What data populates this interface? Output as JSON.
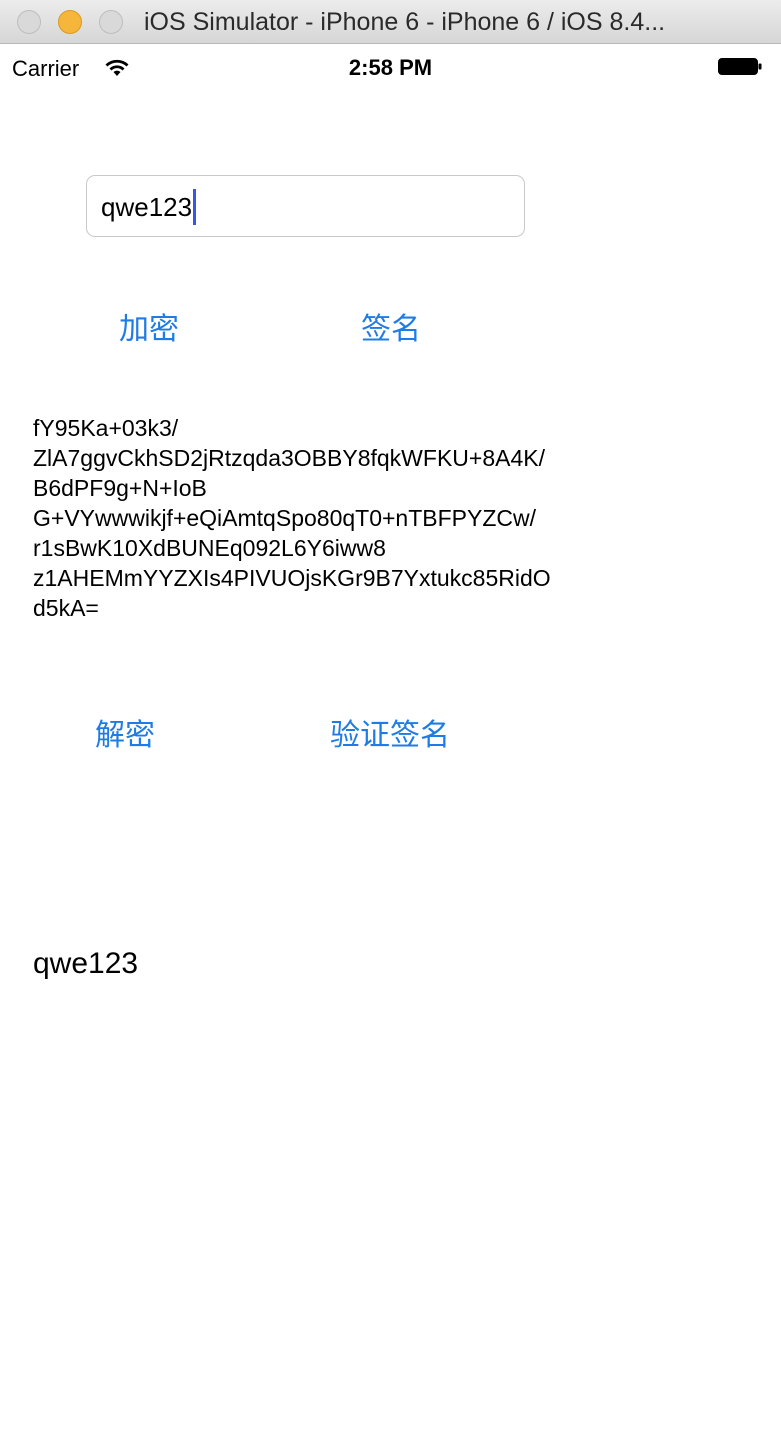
{
  "window": {
    "title": "iOS Simulator - iPhone 6 - iPhone 6 / iOS 8.4..."
  },
  "status_bar": {
    "carrier": "Carrier",
    "time": "2:58 PM",
    "wifi_icon": "wifi-icon",
    "battery_icon": "battery-icon"
  },
  "input": {
    "value": "qwe123"
  },
  "buttons": {
    "encrypt": "加密",
    "sign": "签名",
    "decrypt": "解密",
    "verify_sign": "验证签名"
  },
  "ciphertext": "fY95Ka+03k3/\nZlA7ggvCkhSD2jRtzqda3OBBY8fqkWFKU+8A4K/\nB6dPF9g+N+IoB\nG+VYwwwikjf+eQiAmtqSpo80qT0+nTBFPYZCw/\nr1sBwK10XdBUNEq092L6Y6iww8\nz1AHEMmYYZXIs4PIVUOjsKGr9B7Yxtukc85RidO\nd5kA=",
  "decrypted_result": "qwe123",
  "colors": {
    "accent": "#1e7ce6",
    "caret": "#3a55e6"
  }
}
